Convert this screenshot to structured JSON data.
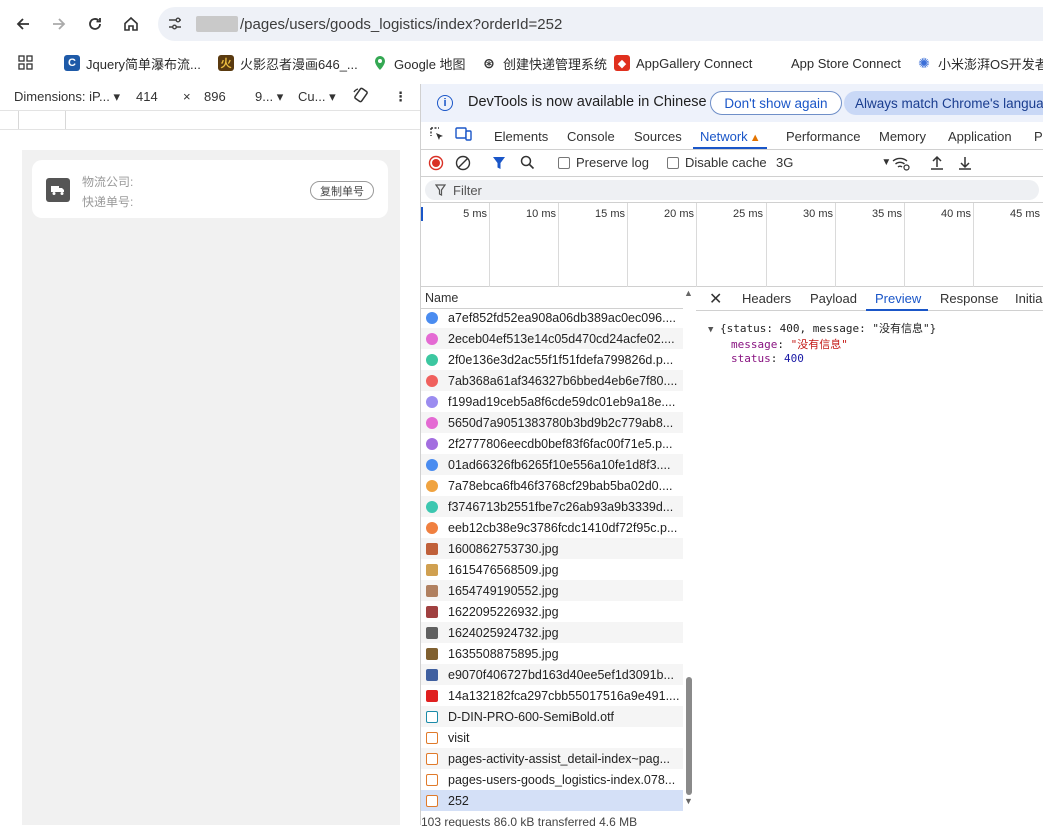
{
  "browser": {
    "url_path": "/pages/users/goods_logistics/index?orderId=252",
    "bookmarks": [
      {
        "label": "Jquery简单瀑布流...",
        "icon": "jquery-icon",
        "color": "#1e5aa8"
      },
      {
        "label": "火影忍者漫画646_...",
        "icon": "naruto-icon",
        "color": "#b8860b"
      },
      {
        "label": "Google 地图",
        "icon": "maps-pin-icon",
        "color": "#34a853"
      },
      {
        "label": "创建快递管理系统",
        "icon": "openai-icon",
        "color": "#333333"
      },
      {
        "label": "AppGallery Connect",
        "icon": "appgallery-icon",
        "color": "#e0301e"
      },
      {
        "label": "App Store Connect",
        "icon": "apple-icon",
        "color": "#333333"
      },
      {
        "label": "小米澎湃OS开发者...",
        "icon": "xiaomi-hyperos-icon",
        "color": "#3b6fd8"
      }
    ]
  },
  "device_toolbar": {
    "dimensions_label": "Dimensions: iP...",
    "width": "414",
    "times": "×",
    "height": "896",
    "zoom": "9...",
    "throttle": "Cu..."
  },
  "page": {
    "company_label": "物流公司:",
    "tracking_label": "快递单号:",
    "copy_button": "复制单号"
  },
  "devtools": {
    "info_text": "DevTools is now available in Chinese",
    "dont_show_again": "Don't show again",
    "always_match": "Always match Chrome's language",
    "tabs": [
      "Elements",
      "Console",
      "Sources",
      "Network",
      "Performance",
      "Memory",
      "Application",
      "Pr"
    ],
    "active_tab": "Network",
    "preserve_log": "Preserve log",
    "disable_cache": "Disable cache",
    "throttling": "3G",
    "filter_placeholder": "Filter",
    "timeline_labels": [
      "5 ms",
      "10 ms",
      "15 ms",
      "20 ms",
      "25 ms",
      "30 ms",
      "35 ms",
      "40 ms",
      "45 ms"
    ],
    "name_header": "Name",
    "requests": [
      {
        "name": "a7ef852fd52ea908a06db389ac0ec096....",
        "icon_color": "#4a8cf0"
      },
      {
        "name": "2eceb04ef513e14c05d470cd24acfe02....",
        "icon_color": "#e46ad3"
      },
      {
        "name": "2f0e136e3d2ac55f1f51fdefa799826d.p...",
        "icon_color": "#3cc7a0"
      },
      {
        "name": "7ab368a61af346327b6bbed4eb6e7f80....",
        "icon_color": "#f0605d"
      },
      {
        "name": "f199ad19ceb5a8f6cde59dc01eb9a18e....",
        "icon_color": "#9b8cf0"
      },
      {
        "name": "5650d7a9051383780b3bd9b2c779ab8...",
        "icon_color": "#e46ad3"
      },
      {
        "name": "2f2777806eecdb0bef83f6fac00f71e5.p...",
        "icon_color": "#a36ee0"
      },
      {
        "name": "01ad66326fb6265f10e556a10fe1d8f3....",
        "icon_color": "#4a8cf0"
      },
      {
        "name": "7a78ebca6fb46f3768cf29bab5ba02d0....",
        "icon_color": "#f0a340"
      },
      {
        "name": "f3746713b2551fbe7c26ab93a9b3339d...",
        "icon_color": "#3cc7b0"
      },
      {
        "name": "eeb12cb38e9c3786fcdc1410df72f95c.p...",
        "icon_color": "#f08040"
      },
      {
        "name": "1600862753730.jpg",
        "icon_color": "#c0603a"
      },
      {
        "name": "1615476568509.jpg",
        "icon_color": "#d0a050"
      },
      {
        "name": "1654749190552.jpg",
        "icon_color": "#b08060"
      },
      {
        "name": "1622095226932.jpg",
        "icon_color": "#a04040"
      },
      {
        "name": "1624025924732.jpg",
        "icon_color": "#606060"
      },
      {
        "name": "1635508875895.jpg",
        "icon_color": "#806030"
      },
      {
        "name": "e9070f406727bd163d40ee5ef1d3091b...",
        "icon_color": "#4060a0"
      },
      {
        "name": "14a132182fca297cbb55017516a9e491....",
        "icon_color": "#e02020"
      },
      {
        "name": "D-DIN-PRO-600-SemiBold.otf",
        "icon_color": "#1a8aa8"
      },
      {
        "name": "visit",
        "icon_color": "#e07a2a"
      },
      {
        "name": "pages-activity-assist_detail-index~pag...",
        "icon_color": "#e07a2a"
      },
      {
        "name": "pages-users-goods_logistics-index.078...",
        "icon_color": "#e07a2a"
      },
      {
        "name": "252",
        "icon_color": "#e07a2a"
      }
    ],
    "status_bar": "103 requests   86.0 kB transferred   4.6 MB",
    "detail_tabs": [
      "Headers",
      "Payload",
      "Preview",
      "Response",
      "Initia"
    ],
    "active_detail_tab": "Preview",
    "preview": {
      "summary": "{status: 400, message: \"没有信息\"}",
      "message_key": "message",
      "message_value": "\"没有信息\"",
      "status_key": "status",
      "status_value": "400"
    }
  }
}
